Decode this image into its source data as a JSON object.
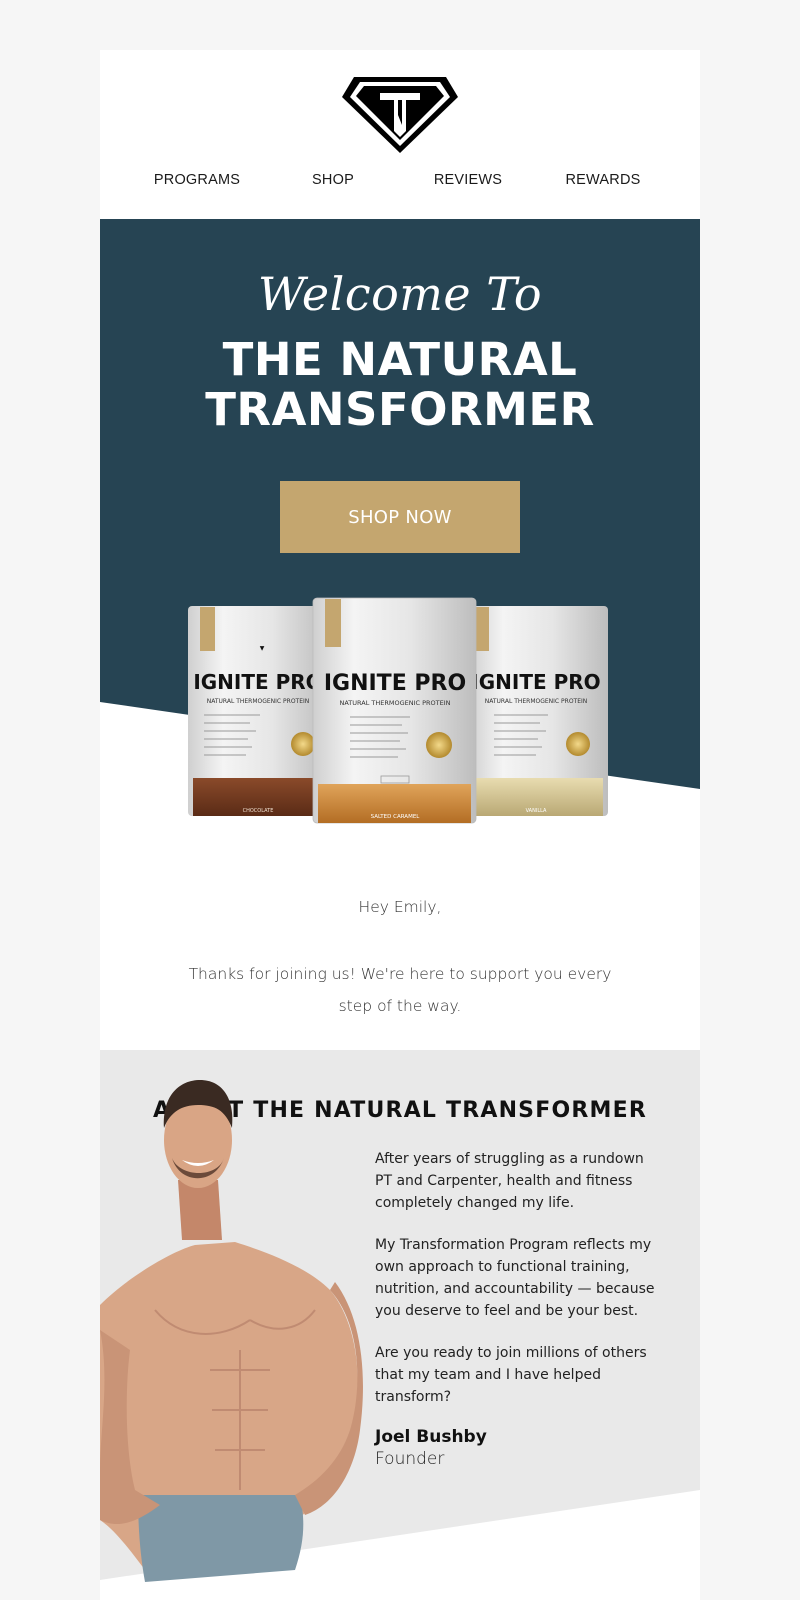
{
  "nav": [
    "PROGRAMS",
    "SHOP",
    "REVIEWS",
    "REWARDS"
  ],
  "hero": {
    "welcome": "Welcome To",
    "title_line1": "THE NATURAL",
    "title_line2": "TRANSFORMER",
    "cta": "SHOP NOW"
  },
  "products": [
    {
      "brand": "IGNITE PRO",
      "subtitle": "NATURAL THERMOGENIC PROTEIN",
      "flavor": "CHOCOLATE",
      "badge": "100%"
    },
    {
      "brand": "IGNITE PRO",
      "subtitle": "NATURAL THERMOGENIC PROTEIN",
      "flavor": "SALTED CARAMEL",
      "badge": "100%"
    },
    {
      "brand": "IGNITE PRO",
      "subtitle": "NATURAL THERMOGENIC PROTEIN",
      "flavor": "VANILLA",
      "badge": "100%"
    }
  ],
  "greeting": {
    "hey": "Hey Emily,",
    "message": "Thanks for joining us! We're here to support you every step of the way."
  },
  "about": {
    "title": "ABOUT THE NATURAL TRANSFORMER",
    "paragraphs": [
      "After years of struggling as a rundown PT and Carpenter, health and fitness completely changed my life.",
      "My Transformation Program reflects my own approach to functional training, nutrition, and accountability — because you deserve to feel and be your best.",
      "Are you ready to join millions of others that my team and I have helped transform?"
    ],
    "name": "Joel Bushby",
    "role": "Founder"
  },
  "colors": {
    "hero_bg": "#264453",
    "gold": "#c4a66f",
    "about_bg": "#e9e9e9",
    "page_bg": "#f6f6f6"
  }
}
